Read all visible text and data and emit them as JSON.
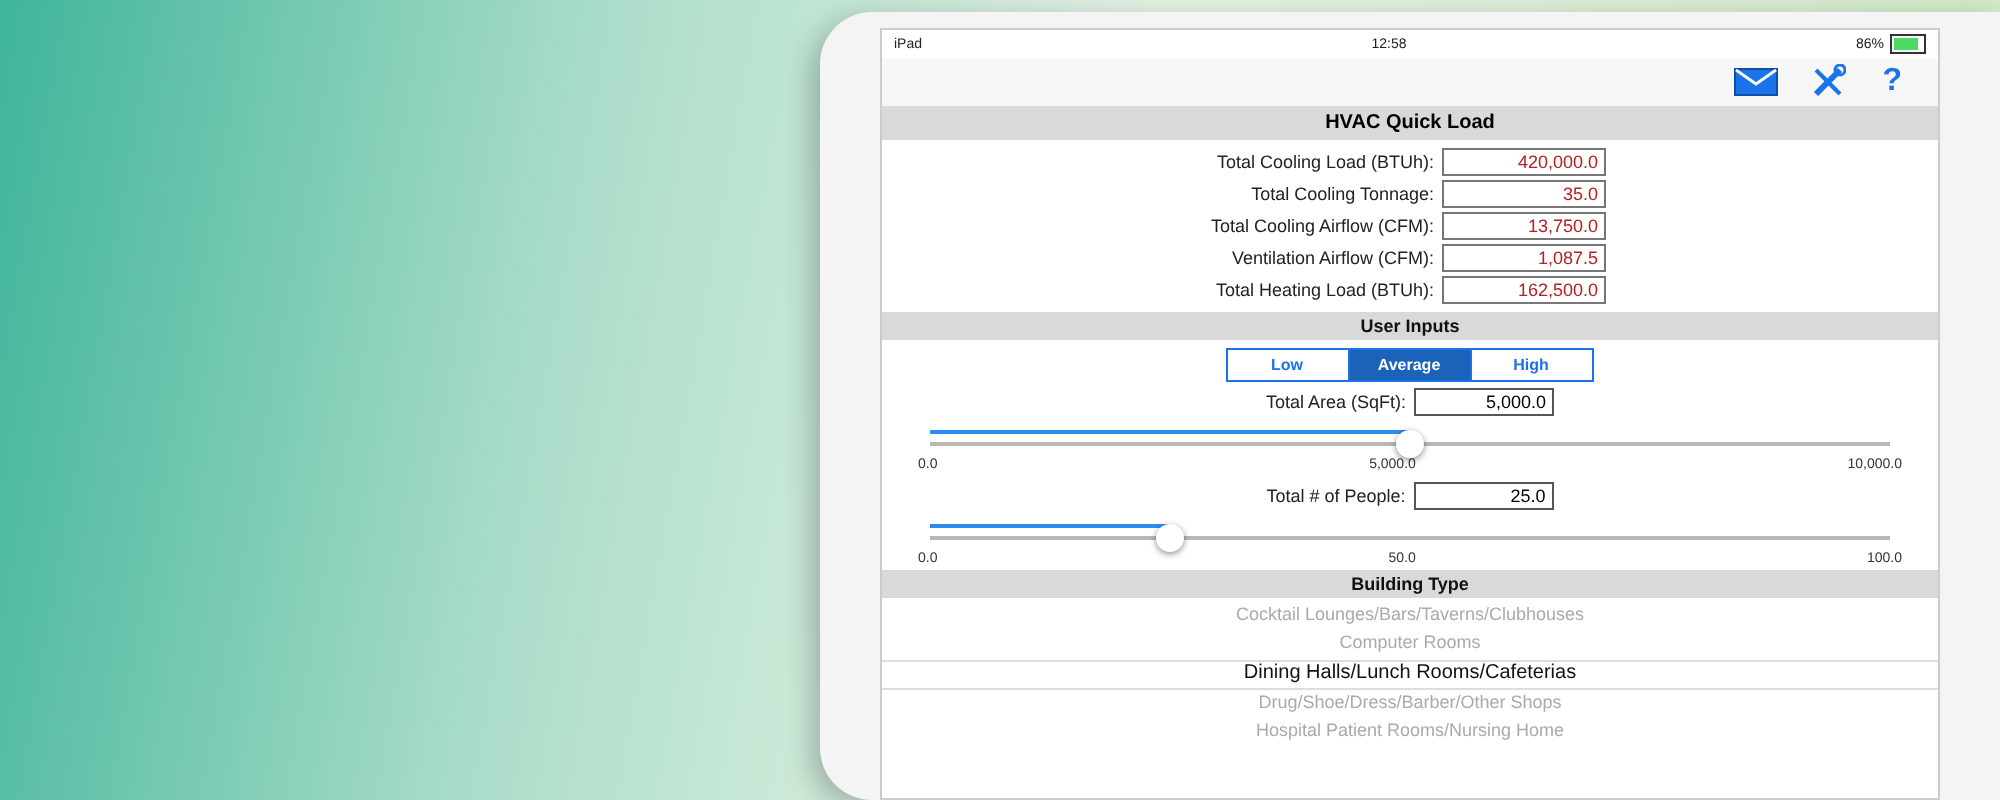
{
  "status_bar": {
    "device": "iPad",
    "time": "12:58",
    "battery": "86%"
  },
  "toolbar": {
    "buttons": [
      {
        "kind": "mail"
      },
      {
        "kind": "tools"
      },
      {
        "kind": "help",
        "label": "?"
      }
    ]
  },
  "title": "HVAC Quick Load",
  "results": [
    {
      "label": "Total Cooling Load (BTUh):",
      "value": "420,000.0"
    },
    {
      "label": "Total Cooling Tonnage:",
      "value": "35.0"
    },
    {
      "label": "Total Cooling Airflow (CFM):",
      "value": "13,750.0"
    },
    {
      "label": "Ventilation Airflow (CFM):",
      "value": "1,087.5"
    },
    {
      "label": "Total Heating Load (BTUh):",
      "value": "162,500.0"
    }
  ],
  "user_inputs": {
    "title": "User Inputs",
    "load_levels": [
      {
        "label": "Low",
        "selected": false
      },
      {
        "label": "Average",
        "selected": true
      },
      {
        "label": "High",
        "selected": false
      }
    ],
    "sliders": [
      {
        "label": "Total Area (SqFt):",
        "value": "5,000.0",
        "level": 0.5,
        "ticks": [
          "0.0",
          "5,000.0",
          "10,000.0"
        ]
      },
      {
        "label": "Total # of People:",
        "value": "25.0",
        "level": 0.25,
        "ticks": [
          "0.0",
          "50.0",
          "100.0"
        ]
      }
    ]
  },
  "building_type": {
    "title": "Building Type",
    "options": [
      {
        "label": "Cocktail Lounges/Bars/Taverns/Clubhouses",
        "selected": false
      },
      {
        "label": "Computer Rooms",
        "selected": false
      },
      {
        "label": "Dining Halls/Lunch Rooms/Cafeterias",
        "selected": true
      },
      {
        "label": "Drug/Shoe/Dress/Barber/Other Shops",
        "selected": false
      },
      {
        "label": "Hospital Patient Rooms/Nursing Home",
        "selected": false
      }
    ]
  }
}
